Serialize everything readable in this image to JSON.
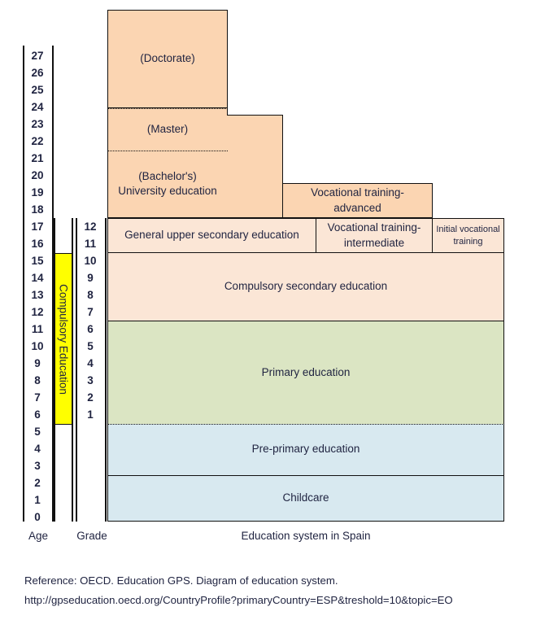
{
  "diagram": {
    "title": "Education system in Spain",
    "age_axis_caption": "Age",
    "grade_axis_caption": "Grade",
    "compulsory_label": "Compulsory Education",
    "age_ticks": [
      "27",
      "26",
      "25",
      "24",
      "23",
      "22",
      "21",
      "20",
      "19",
      "18",
      "17",
      "16",
      "15",
      "14",
      "13",
      "12",
      "11",
      "10",
      "9",
      "8",
      "7",
      "6",
      "5",
      "4",
      "3",
      "2",
      "1",
      "0"
    ],
    "grade_ticks": [
      "12",
      "11",
      "10",
      "9",
      "8",
      "7",
      "6",
      "5",
      "4",
      "3",
      "2",
      "1"
    ],
    "age_range": [
      0,
      27
    ],
    "grade_range": [
      1,
      12
    ],
    "compulsory_age_span": [
      6,
      16
    ],
    "blocks": [
      {
        "id": "doctorate",
        "label": "(Doctorate)",
        "color": "#fbd5b2",
        "age_span": [
          24,
          28
        ],
        "track": "university"
      },
      {
        "id": "master",
        "label": "(Master)",
        "color": "#fbd5b2",
        "age_span": [
          22,
          24
        ],
        "track": "university"
      },
      {
        "id": "bachelors",
        "label": "(Bachelor's)\nUniversity education",
        "line1": "(Bachelor's)",
        "line2": "University education",
        "color": "#fbd5b2",
        "age_span": [
          18,
          22
        ],
        "track": "university"
      },
      {
        "id": "vocational-advanced",
        "label": "Vocational training-advanced",
        "line1": "Vocational training-",
        "line2": "advanced",
        "color": "#fbd5b2",
        "age_span": [
          18,
          21
        ],
        "track": "vocational"
      },
      {
        "id": "general-upper-secondary",
        "label": "General upper secondary education",
        "color": "#fbe6d6",
        "age_span": [
          16,
          18
        ],
        "track": "general"
      },
      {
        "id": "vocational-intermediate",
        "label": "Vocational training-intermediate",
        "line1": "Vocational training-",
        "line2": "intermediate",
        "color": "#fbe6d6",
        "age_span": [
          16,
          18
        ],
        "track": "vocational"
      },
      {
        "id": "initial-vocational-training",
        "label": "Initial vocational training",
        "line1": "Initial vocational",
        "line2": "training",
        "color": "#fbe6d6",
        "age_span": [
          16,
          18
        ],
        "track": "initial-vocational"
      },
      {
        "id": "compulsory-secondary",
        "label": "Compulsory secondary education",
        "color": "#fbe6d6",
        "age_span": [
          12,
          16
        ],
        "track": "main"
      },
      {
        "id": "primary",
        "label": "Primary education",
        "color": "#dbe5c3",
        "age_span": [
          6,
          12
        ],
        "track": "main"
      },
      {
        "id": "pre-primary",
        "label": "Pre-primary education",
        "color": "#d8e9f0",
        "age_span": [
          3,
          6
        ],
        "track": "main"
      },
      {
        "id": "childcare",
        "label": "Childcare",
        "color": "#d8e9f0",
        "age_span": [
          0,
          3
        ],
        "track": "main"
      }
    ]
  },
  "footer": {
    "line1": "Reference:   OECD. Education GPS. Diagram of education system.",
    "line2": "http://gpseducation.oecd.org/CountryProfile?primaryCountry=ESP&treshold=10&topic=EO"
  }
}
